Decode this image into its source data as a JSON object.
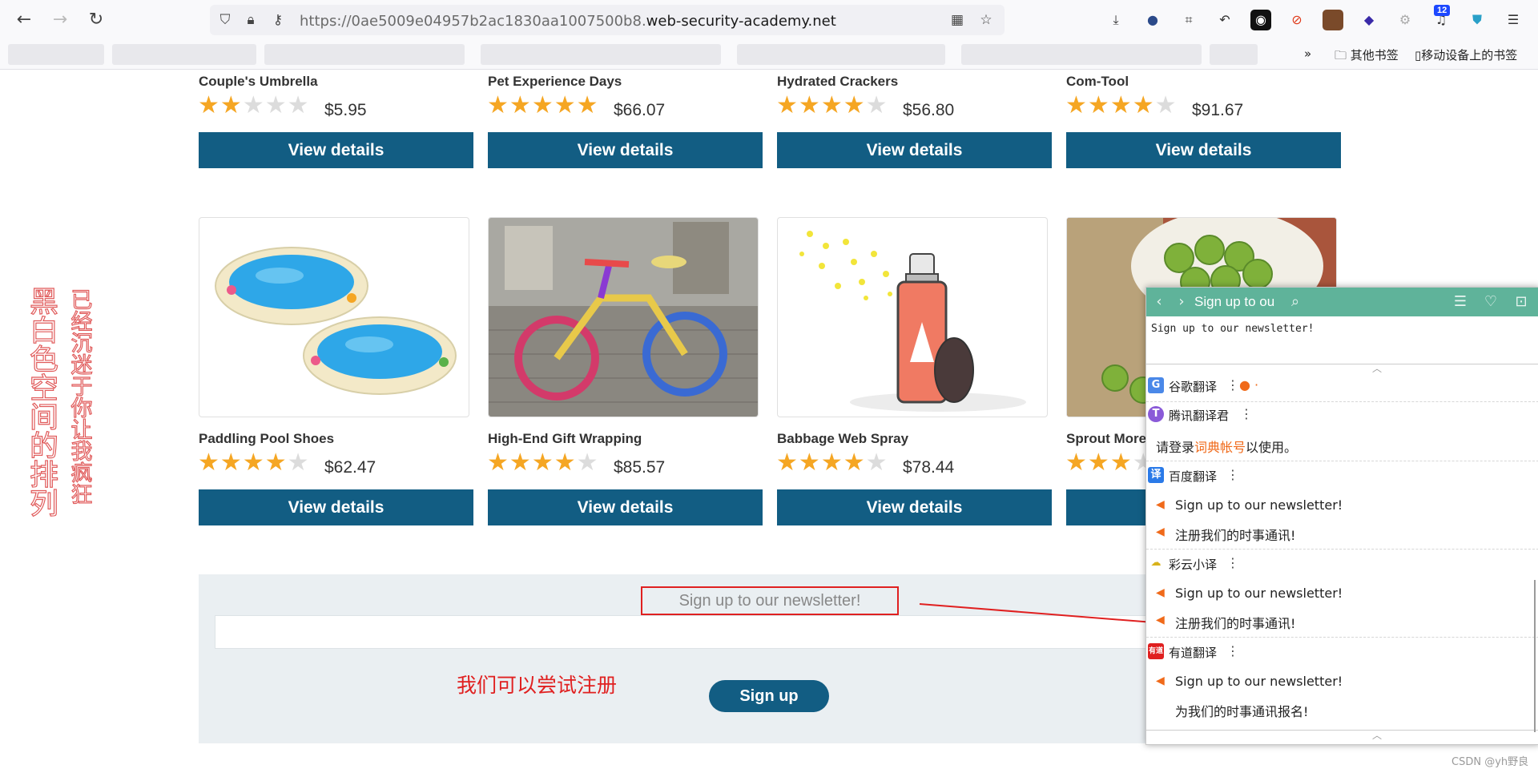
{
  "browser": {
    "url_prefix": "https://0ae5009e04957b2ac1830aa1007500b8.",
    "url_host": "web-security-academy.net",
    "extension_badge": "12",
    "bookmarks_right": [
      "其他书签",
      "移动设备上的书签"
    ]
  },
  "products_row1": [
    {
      "title": "Couple's Umbrella",
      "rating": 2,
      "price": "$5.95",
      "button": "View details"
    },
    {
      "title": "Pet Experience Days",
      "rating": 5,
      "price": "$66.07",
      "button": "View details"
    },
    {
      "title": "Hydrated Crackers",
      "rating": 4,
      "price": "$56.80",
      "button": "View details"
    },
    {
      "title": "Com-Tool",
      "rating": 4,
      "price": "$91.67",
      "button": "View details"
    }
  ],
  "products_row2": [
    {
      "title": "Paddling Pool Shoes",
      "rating": 4,
      "price": "$62.47",
      "button": "View details"
    },
    {
      "title": "High-End Gift Wrapping",
      "rating": 4,
      "price": "$85.57",
      "button": "View details"
    },
    {
      "title": "Babbage Web Spray",
      "rating": 4,
      "price": "$78.44",
      "button": "View details"
    },
    {
      "title": "Sprout More",
      "rating": 3,
      "price": "",
      "button": ""
    }
  ],
  "side_text": {
    "col1": "黑白色空间的排列",
    "col2": "已经沉迷于你让我疯狂"
  },
  "newsletter": {
    "heading": "Sign up to our newsletter!",
    "button": "Sign up",
    "annotation": "我们可以尝试注册"
  },
  "popup": {
    "title": "Sign up to ou",
    "query": "Sign up to our newsletter!",
    "engines": [
      {
        "name": "谷歌翻译",
        "logo": "G"
      },
      {
        "name": "腾讯翻译君",
        "logo": "T",
        "login_prefix": "请登录",
        "login_link": "词典帐号",
        "login_suffix": "以使用。"
      },
      {
        "name": "百度翻译",
        "logo": "译",
        "source": "Sign up to our newsletter!",
        "translation": "注册我们的时事通讯!"
      },
      {
        "name": "彩云小译",
        "logo": "☁",
        "source": "Sign up to our newsletter!",
        "translation": "注册我们的时事通讯!"
      },
      {
        "name": "有道翻译",
        "logo": "有道",
        "source": "Sign up to our newsletter!",
        "translation": "为我们的时事通讯报名!"
      }
    ]
  },
  "watermark": "CSDN @yh野良",
  "colors": {
    "button_blue": "#125d83",
    "star": "#f5a623",
    "popup_green": "#5fb39a",
    "annotation_red": "#e02020"
  }
}
